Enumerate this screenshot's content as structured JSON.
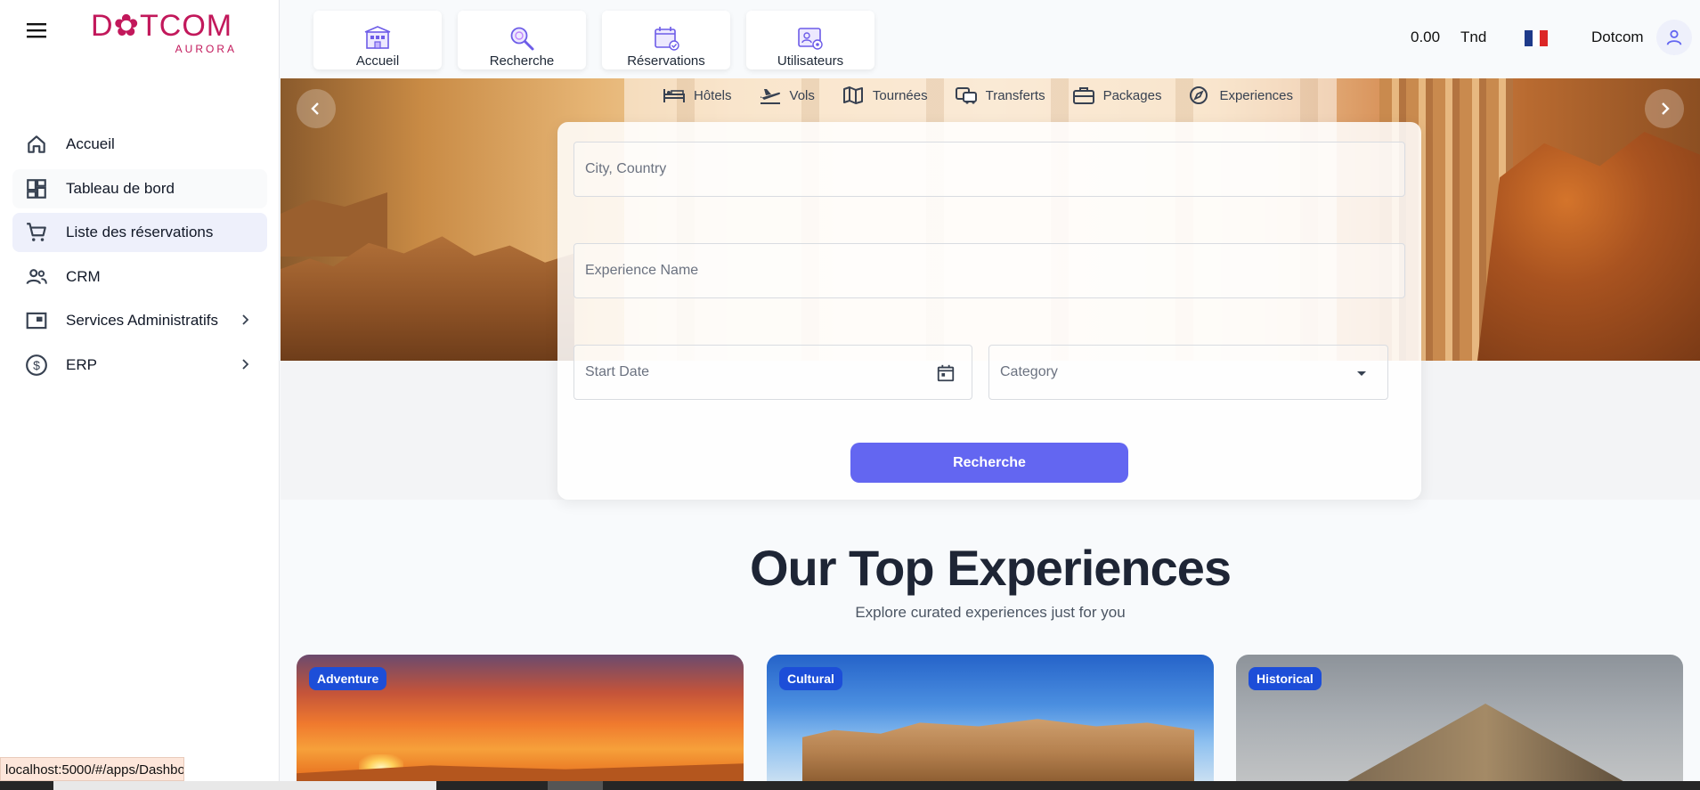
{
  "app": {
    "logo_main": "D✿TCOM",
    "logo_sub": "AURORA"
  },
  "sidebar": {
    "items": [
      {
        "label": "Accueil",
        "icon": "home-icon"
      },
      {
        "label": "Tableau de bord",
        "icon": "dashboard-icon"
      },
      {
        "label": "Liste des réservations",
        "icon": "cart-icon",
        "active": true
      },
      {
        "label": "CRM",
        "icon": "people-icon"
      },
      {
        "label": "Services Administratifs",
        "icon": "card-icon",
        "has_submenu": true
      },
      {
        "label": "ERP",
        "icon": "dollar-icon",
        "has_submenu": true
      }
    ]
  },
  "topnav": {
    "items": [
      {
        "label": "Accueil",
        "icon": "hotel-building-icon"
      },
      {
        "label": "Recherche",
        "icon": "magnifier-icon"
      },
      {
        "label": "Réservations",
        "icon": "calendar-check-icon"
      },
      {
        "label": "Utilisateurs",
        "icon": "user-card-icon"
      }
    ]
  },
  "header": {
    "balance": "0.00",
    "currency": "Tnd",
    "language_flag": "fr",
    "username": "Dotcom"
  },
  "service_tabs": [
    {
      "label": "Hôtels",
      "icon": "bed-icon"
    },
    {
      "label": "Vols",
      "icon": "plane-icon"
    },
    {
      "label": "Tournées",
      "icon": "map-icon"
    },
    {
      "label": "Transferts",
      "icon": "bus-icon"
    },
    {
      "label": "Packages",
      "icon": "briefcase-icon"
    },
    {
      "label": "Experiences",
      "icon": "compass-icon"
    }
  ],
  "search_form": {
    "city_placeholder": "City, Country",
    "experience_placeholder": "Experience Name",
    "start_date_placeholder": "Start Date",
    "category_placeholder": "Category",
    "search_label": "Recherche"
  },
  "section": {
    "title": "Our Top Experiences",
    "subtitle": "Explore curated experiences just for you"
  },
  "cards": [
    {
      "badge": "Adventure"
    },
    {
      "badge": "Cultural"
    },
    {
      "badge": "Historical"
    }
  ],
  "status_url": "localhost:5000/#/apps/Dashbo",
  "colors": {
    "primary": "#6366f1",
    "brand": "#c2185b",
    "badge": "#1d4ed8",
    "active_nav": "#eef0fb"
  }
}
